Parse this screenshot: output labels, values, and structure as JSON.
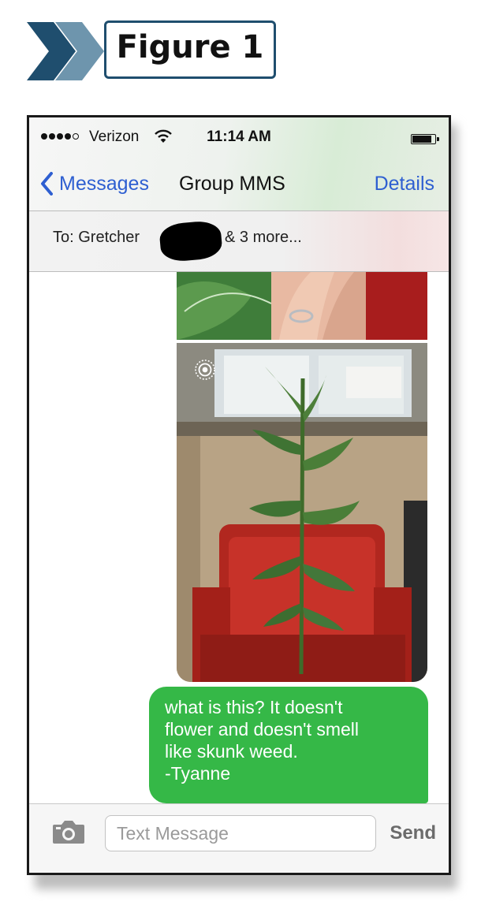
{
  "figure": {
    "label": "Figure 1"
  },
  "status_bar": {
    "signal_bars": 4,
    "signal_total": 5,
    "carrier": "Verizon",
    "wifi_icon": "wifi-icon",
    "time": "11:14 AM",
    "battery_level": 0.85
  },
  "nav": {
    "back_label": "Messages",
    "title": "Group MMS",
    "details_label": "Details"
  },
  "recipients": {
    "to_label": "To: Gretcher",
    "more_label": "& 3 more..."
  },
  "messages": [
    {
      "type": "image",
      "depicts": "plant leaves and a hand with a ring"
    },
    {
      "type": "image",
      "depicts": "plant stalk in front of a red chair"
    },
    {
      "type": "sms",
      "lines": [
        "what is this? It doesn't",
        "flower and doesn't smell",
        "like skunk weed.",
        "-Tyanne"
      ]
    }
  ],
  "input_bar": {
    "camera_icon": "camera-icon",
    "placeholder": "Text Message",
    "value": "",
    "send_label": "Send"
  },
  "colors": {
    "ios_blue": "#2e5fd1",
    "sms_green": "#35b847",
    "banner_navy": "#1f4e6e",
    "banner_steel": "#6e95ad"
  }
}
